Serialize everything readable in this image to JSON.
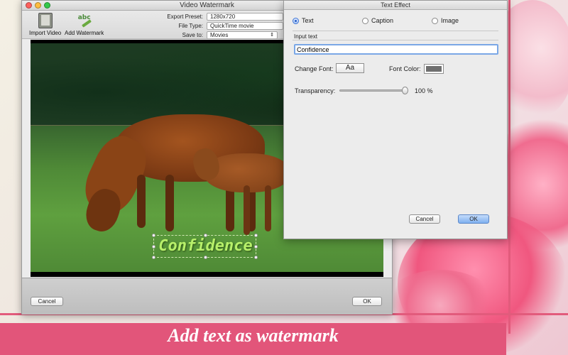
{
  "main_window": {
    "title": "Video Watermark",
    "toolbar": {
      "import_video": "Import Video",
      "add_watermark": "Add Watermark",
      "export_preset_label": "Export Preset:",
      "export_preset_value": "1280x720",
      "file_type_label": "File Type:",
      "file_type_value": "QuickTime movie",
      "save_to_label": "Save to:",
      "save_to_value": "Movies"
    },
    "watermark_text": "Confidence",
    "cancel_label": "Cancel",
    "ok_label": "OK"
  },
  "dialog": {
    "title": "Text Effect",
    "modes": [
      {
        "label": "Text",
        "selected": true
      },
      {
        "label": "Caption",
        "selected": false
      },
      {
        "label": "Image",
        "selected": false
      }
    ],
    "input_text_label": "Input text",
    "input_text_value": "Confidence",
    "change_font_label": "Change Font:",
    "font_button_label": "Aa",
    "font_color_label": "Font Color:",
    "font_color_value": "#6f6f6f",
    "transparency_label": "Transparency:",
    "transparency_value": 100,
    "transparency_display": "100 %",
    "cancel_label": "Cancel",
    "ok_label": "OK"
  },
  "banner": {
    "text": "Add text as watermark"
  },
  "colors": {
    "accent_pink": "#e2557a",
    "watermark_green": "#b7f06a",
    "ok_blue": "#7aa7e6"
  }
}
